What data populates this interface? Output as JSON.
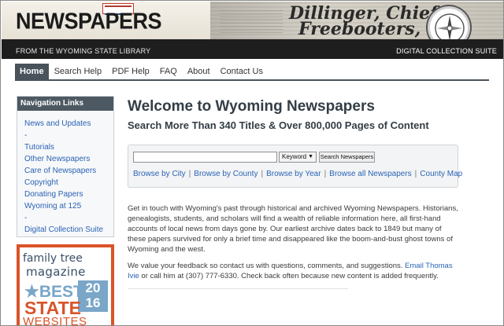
{
  "header": {
    "brand": "NEWSPAPERS",
    "masthead_line1": "Dillinger, Chiefta",
    "masthead_line2": "Freebooters, Shot",
    "subtitle": "FROM THE WYOMING STATE LIBRARY",
    "suite": "DIGITAL COLLECTION SUITE"
  },
  "nav": {
    "items": [
      "Home",
      "Search Help",
      "PDF Help",
      "FAQ",
      "About",
      "Contact Us"
    ]
  },
  "sidebar": {
    "title": "Navigation Links",
    "items": [
      "News and Updates",
      "-",
      "Tutorials",
      "Other Newspapers",
      "Care of Newspapers",
      "Copyright",
      "Donating Papers",
      "Wyoming at 125",
      "-",
      "Digital Collection Suite"
    ]
  },
  "ad": {
    "family": "family tree",
    "magazine": "magazine",
    "best": "BEST",
    "year_top": "20",
    "year_bottom": "16",
    "state": "STATE",
    "websites": "WEBSITES"
  },
  "main": {
    "title": "Welcome to Wyoming Newspapers",
    "subtitle": "Search More Than 340 Titles & Over 800,000 Pages of Content"
  },
  "search": {
    "input_value": "",
    "select_value": "Keyword",
    "button_label": "Search Newspapers",
    "browse_links": [
      "Browse by City",
      "Browse by County",
      "Browse by Year",
      "Browse all Newspapers",
      "County Map"
    ]
  },
  "content": {
    "para1": "Get in touch with Wyoming's past through historical and archived Wyoming Newspapers. Historians, genealogists, students, and scholars will find a wealth of reliable information here, all first-hand accounts of local news from days gone by. Our earliest archive dates back to 1849 but many of these papers survived for only a brief time and disappeared like the boom-and-bust ghost towns of Wyoming and the west.",
    "para2_before": "We value your feedback so contact us with questions, comments, and suggestions. ",
    "para2_link": "Email Thomas Ivie",
    "para2_after": " or call him at (307) 777-6330. Check back often because new content is added frequently."
  },
  "colors": {
    "header_bg": "#1e1e1e",
    "nav_active": "#49535c",
    "link": "#2a63b5",
    "ad_orange": "#d9542a",
    "ad_blue": "#7aa6c8"
  }
}
